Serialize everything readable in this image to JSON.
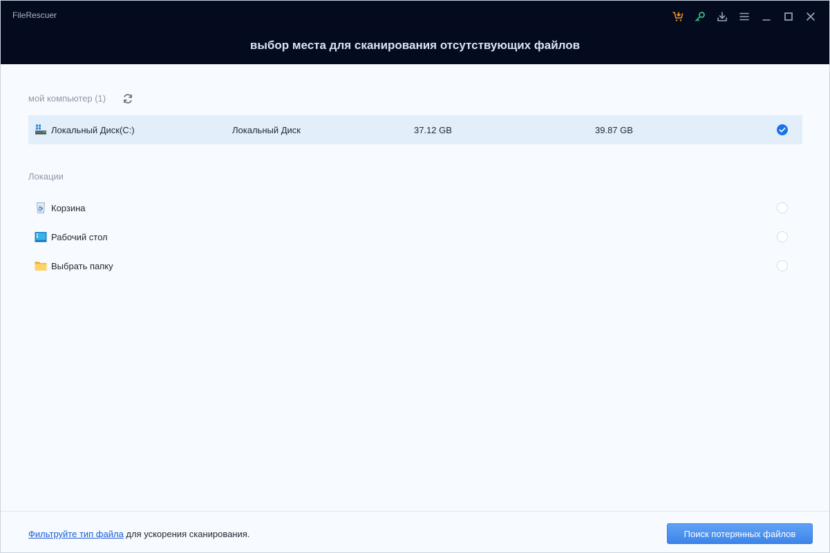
{
  "window": {
    "app_name": "FileRescuer",
    "title": "выбор места для сканирования отсутствующих файлов",
    "toolbar_icons": [
      "cart-icon",
      "key-icon",
      "download-icon",
      "menu-icon",
      "minimize-icon",
      "maximize-icon",
      "close-icon"
    ],
    "colors": {
      "cart": "#e8962e",
      "key": "#34c28a",
      "header_bg": "#050b1f",
      "accent": "#1a73e8"
    }
  },
  "computer_section": {
    "label": "мой компьютер (1)",
    "drives": [
      {
        "name": "Локальный Диск(C:)",
        "type": "Локальный Диск",
        "used": "37.12 GB",
        "total": "39.87 GB",
        "selected": true
      }
    ]
  },
  "locations_section": {
    "label": "Локации",
    "items": [
      {
        "name": "Корзина",
        "icon": "recycle-bin-icon",
        "selected": false
      },
      {
        "name": "Рабочий стол",
        "icon": "desktop-icon",
        "selected": false
      },
      {
        "name": "Выбрать папку",
        "icon": "folder-icon",
        "selected": false
      }
    ]
  },
  "footer": {
    "filter_link": "Фильтруйте тип файла",
    "filter_text": " для ускорения сканирования.",
    "scan_button": "Поиск потерянных файлов"
  }
}
